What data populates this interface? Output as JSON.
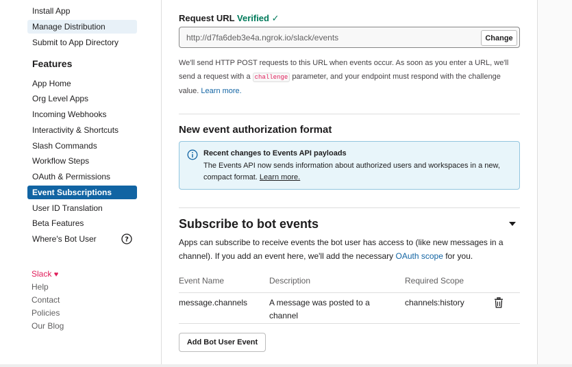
{
  "sidebar": {
    "items_top": [
      {
        "label": "Install App"
      },
      {
        "label": "Manage Distribution"
      },
      {
        "label": "Submit to App Directory"
      }
    ],
    "section_title": "Features",
    "features": [
      {
        "label": "App Home"
      },
      {
        "label": "Org Level Apps"
      },
      {
        "label": "Incoming Webhooks"
      },
      {
        "label": "Interactivity & Shortcuts"
      },
      {
        "label": "Slash Commands"
      },
      {
        "label": "Workflow Steps"
      },
      {
        "label": "OAuth & Permissions"
      },
      {
        "label": "Event Subscriptions"
      },
      {
        "label": "User ID Translation"
      },
      {
        "label": "Beta Features"
      },
      {
        "label": "Where's Bot User"
      }
    ],
    "footer": [
      {
        "label": "Slack"
      },
      {
        "label": "Help"
      },
      {
        "label": "Contact"
      },
      {
        "label": "Policies"
      },
      {
        "label": "Our Blog"
      }
    ]
  },
  "request_url": {
    "label": "Request URL",
    "verified": "Verified",
    "check": "✓",
    "value": "http://d7fa6deb3e4a.ngrok.io/slack/events",
    "change_button": "Change",
    "desc_part1": "We'll send HTTP POST requests to this URL when events occur. As soon as you enter a URL, we'll send a request with a",
    "code": "challenge",
    "desc_part2": "parameter, and your endpoint must respond with the challenge value.",
    "learn_more": "Learn more."
  },
  "auth_format": {
    "heading": "New event authorization format",
    "info_title": "Recent changes to Events API payloads",
    "info_body": "The Events API now sends information about authorized users and workspaces in a new, compact format.",
    "info_link": "Learn more."
  },
  "bot_events": {
    "heading": "Subscribe to bot events",
    "desc_part1": "Apps can subscribe to receive events the bot user has access to (like new messages in a channel). If you add an event here, we'll add the necessary",
    "oauth_link": "OAuth scope",
    "desc_part2": "for you.",
    "columns": [
      "Event Name",
      "Description",
      "Required Scope"
    ],
    "rows": [
      {
        "event": "message.channels",
        "description": "A message was posted to a channel",
        "scope": "channels:history"
      }
    ],
    "add_button": "Add Bot User Event"
  },
  "colors": {
    "active": "#1164a3",
    "link": "#1264a3",
    "verified": "#007a5a",
    "slack_heart": "#e01e5a"
  }
}
